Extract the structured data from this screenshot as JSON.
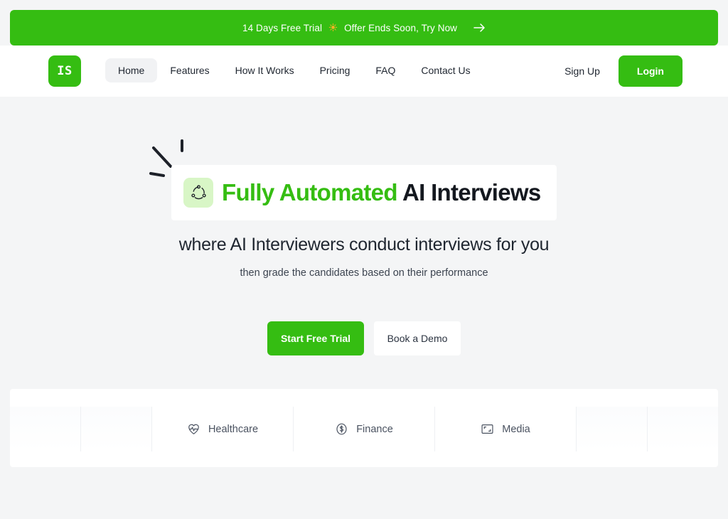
{
  "theme": {
    "brand_green": "#35bd12",
    "badge_green": "#d8f6c6",
    "page_bg": "#f4f5f6",
    "text_dark": "#14181f"
  },
  "promo": {
    "text_before": "14 Days Free Trial",
    "star_icon": "sparkle-star-icon",
    "text_after": "Offer Ends Soon, Try Now",
    "arrow_icon": "arrow-right-icon"
  },
  "nav": {
    "logo_text": "IS",
    "links": [
      {
        "label": "Home",
        "active": true
      },
      {
        "label": "Features",
        "active": false
      },
      {
        "label": "How It Works",
        "active": false
      },
      {
        "label": "Pricing",
        "active": false
      },
      {
        "label": "FAQ",
        "active": false
      },
      {
        "label": "Contact Us",
        "active": false
      }
    ],
    "signup_label": "Sign Up",
    "login_label": "Login"
  },
  "hero": {
    "badge_icon": "network-nodes-icon",
    "headline_accent": "Fully Automated",
    "headline_rest": " AI Interviews",
    "subhead": "where AI Interviewers conduct interviews for you",
    "subhead2": "then grade the candidates based on their performance",
    "primary_cta": "Start Free Trial",
    "secondary_cta": "Book a Demo"
  },
  "industries": [
    {
      "label": "Healthcare",
      "icon": "heart-pulse-icon"
    },
    {
      "label": "Finance",
      "icon": "dollar-circle-icon"
    },
    {
      "label": "Media",
      "icon": "media-frame-icon"
    }
  ]
}
